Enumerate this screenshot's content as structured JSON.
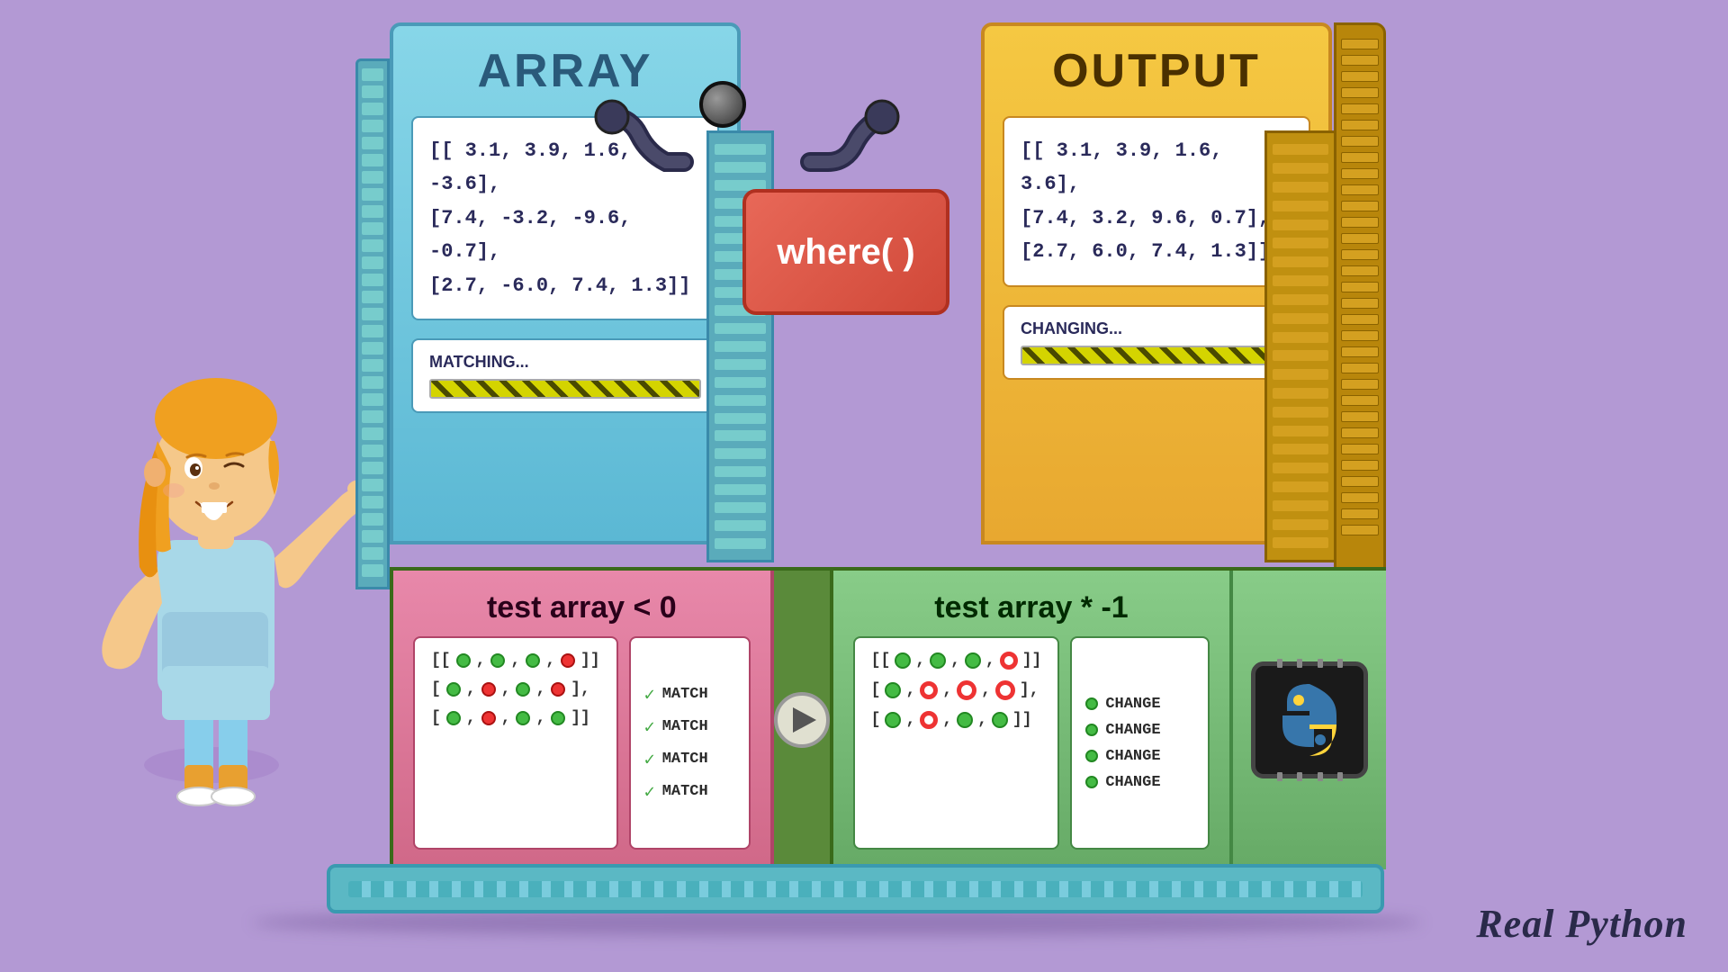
{
  "background_color": "#b399d4",
  "array_panel": {
    "title": "ARRAY",
    "content": "[[ 3.1, 3.9, 1.6, -3.6],\n [7.4, -3.2, -9.6, -0.7],\n [2.7, -6.0, 7.4, 1.3]]",
    "status_label": "MATCHING...",
    "progress": 75
  },
  "output_panel": {
    "title": "OUTPUT",
    "content": "[[ 3.1, 3.9, 1.6, 3.6],\n [7.4, 3.2, 9.6, 0.7],\n [2.7, 6.0, 7.4, 1.3]]",
    "status_label": "CHANGING...",
    "progress": 75
  },
  "where_box": {
    "label": "where( )"
  },
  "test_left": {
    "title": "test array < 0",
    "dot_rows": [
      [
        "green",
        "green",
        "green",
        "red"
      ],
      [
        "green",
        "red",
        "green",
        "red"
      ],
      [
        "green",
        "red",
        "green",
        "green"
      ]
    ],
    "match_items": [
      "MATCH",
      "MATCH",
      "MATCH",
      "MATCH"
    ]
  },
  "test_right": {
    "title": "test array * -1",
    "dot_rows": [
      [
        "green",
        "green",
        "green",
        "red-ring"
      ],
      [
        "green",
        "red-ring",
        "red-ring",
        "red-ring"
      ],
      [
        "green",
        "red-ring",
        "green",
        "green"
      ]
    ],
    "change_items": [
      "CHANGE",
      "CHANGE",
      "CHANGE",
      "CHANGE"
    ]
  },
  "play_button": {
    "label": "▶"
  },
  "watermark": {
    "line1": "Real Python"
  },
  "python_chip": {
    "icon": "🐍"
  }
}
